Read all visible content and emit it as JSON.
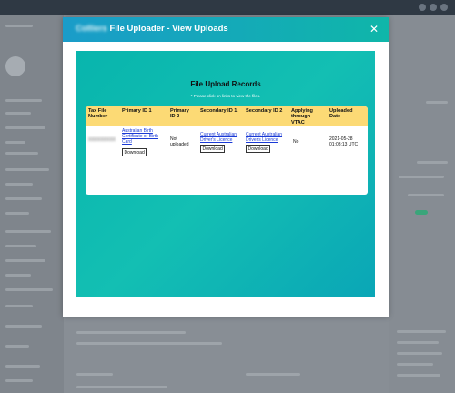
{
  "modal": {
    "title_prefix": "Colliers",
    "title": "File Uploader - View Uploads",
    "close_glyph": "✕"
  },
  "content": {
    "title": "File Upload Records",
    "note": "* Please click on links to view the files."
  },
  "table": {
    "headers": [
      "Tax File Number",
      "Primary ID 1",
      "Primary ID 2",
      "Secondary ID 1",
      "Secondary ID 2",
      "Applying through VTAC",
      "Uploaded Date"
    ],
    "row": {
      "tax_file_number": "XXXXXXXXX",
      "primary_id_1": "Australian Birth Certificate or Birth Card",
      "primary_id_2": "Not uploaded",
      "secondary_id_1": "Current Australian Driver's Licence",
      "secondary_id_2": "Current Australian Driver's Licence",
      "applying_through_vtac": "No",
      "uploaded_date": "2021-05-28 01:03:13 UTC"
    },
    "download_label": "Download"
  },
  "colors": {
    "header_gradient": [
      "#1a9cc9",
      "#0fb6a9"
    ],
    "content_teal": "#0bb5ae",
    "table_header": "#fcda75",
    "link": "#1a3ad6"
  }
}
